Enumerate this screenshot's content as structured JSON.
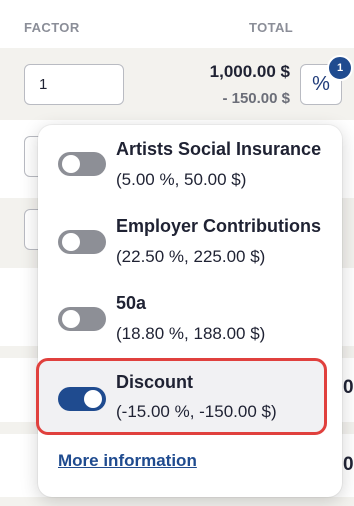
{
  "table": {
    "header": {
      "factor": "FACTOR",
      "total": "TOTAL"
    },
    "row1": {
      "factor_value": "1",
      "total": "1,000.00 $",
      "discount": "- 150.00 $",
      "percent_button": "%",
      "badge_count": "1"
    }
  },
  "popover": {
    "options": [
      {
        "title": "Artists Social Insurance",
        "detail": "(5.00 %, 50.00 $)",
        "enabled": false
      },
      {
        "title": "Employer Contributions",
        "detail": "(22.50 %, 225.00 $)",
        "enabled": false
      },
      {
        "title": "50a",
        "detail": "(18.80 %, 188.00 $)",
        "enabled": false
      },
      {
        "title": "Discount",
        "detail": "(-15.00 %, -150.00 $)",
        "enabled": true
      }
    ],
    "more_link": "More information"
  },
  "colors": {
    "accent": "#1f4b8f",
    "highlight": "#e0403d",
    "toggle_off": "#8d8f96"
  }
}
